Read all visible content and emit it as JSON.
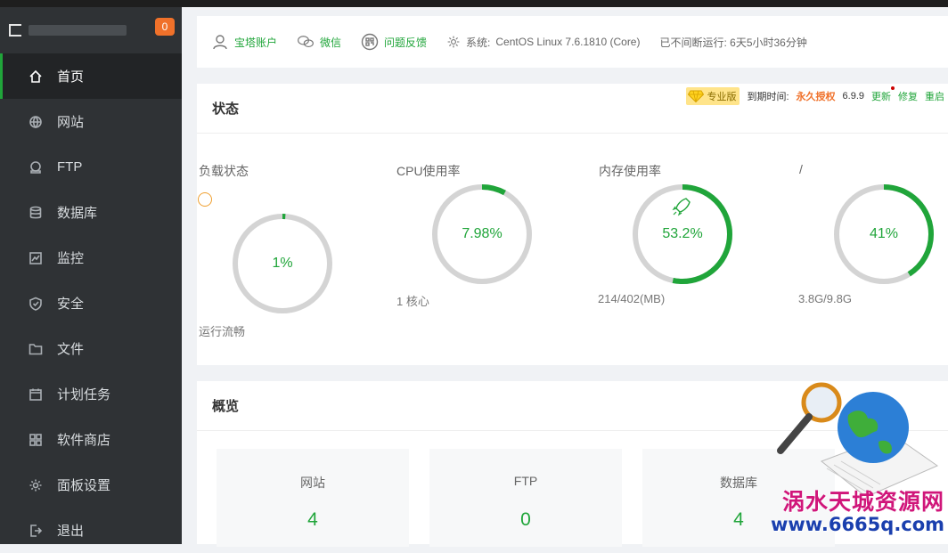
{
  "sidebar": {
    "badge": "0",
    "items": [
      {
        "label": "首页"
      },
      {
        "label": "网站"
      },
      {
        "label": "FTP"
      },
      {
        "label": "数据库"
      },
      {
        "label": "监控"
      },
      {
        "label": "安全"
      },
      {
        "label": "文件"
      },
      {
        "label": "计划任务"
      },
      {
        "label": "软件商店"
      },
      {
        "label": "面板设置"
      },
      {
        "label": "退出"
      }
    ]
  },
  "topbar": {
    "account": "宝塔账户",
    "wechat": "微信",
    "feedback": "问题反馈",
    "system_label": "系统:",
    "system_value": "CentOS Linux 7.6.1810 (Core)",
    "uptime": "已不间断运行: 6天5小时36分钟"
  },
  "status": {
    "title": "状态",
    "pro_label": "专业版",
    "expire_label": "到期时间:",
    "expire_value": "永久授权",
    "version": "6.9.9",
    "update": "更新",
    "repair": "修复",
    "restart": "重启",
    "gauges": [
      {
        "title": "负载状态",
        "value": "1%",
        "sub": "运行流畅",
        "percent": 1
      },
      {
        "title": "CPU使用率",
        "value": "7.98%",
        "sub": "1 核心",
        "percent": 7.98
      },
      {
        "title": "内存使用率",
        "value": "53.2%",
        "sub": "214/402(MB)",
        "percent": 53.2
      },
      {
        "title": "/",
        "value": "41%",
        "sub": "3.8G/9.8G",
        "percent": 41
      }
    ]
  },
  "overview": {
    "title": "概览",
    "cards": [
      {
        "label": "网站",
        "value": "4"
      },
      {
        "label": "FTP",
        "value": "0"
      },
      {
        "label": "数据库",
        "value": "4"
      }
    ]
  },
  "watermark": {
    "line1": "涡水天城资源网",
    "line2": "www.6665q.com"
  },
  "colors": {
    "accent": "#20a53a",
    "sidebar_bg": "#2f3235",
    "badge": "#f0712a",
    "ring_track": "#d4d4d4"
  }
}
